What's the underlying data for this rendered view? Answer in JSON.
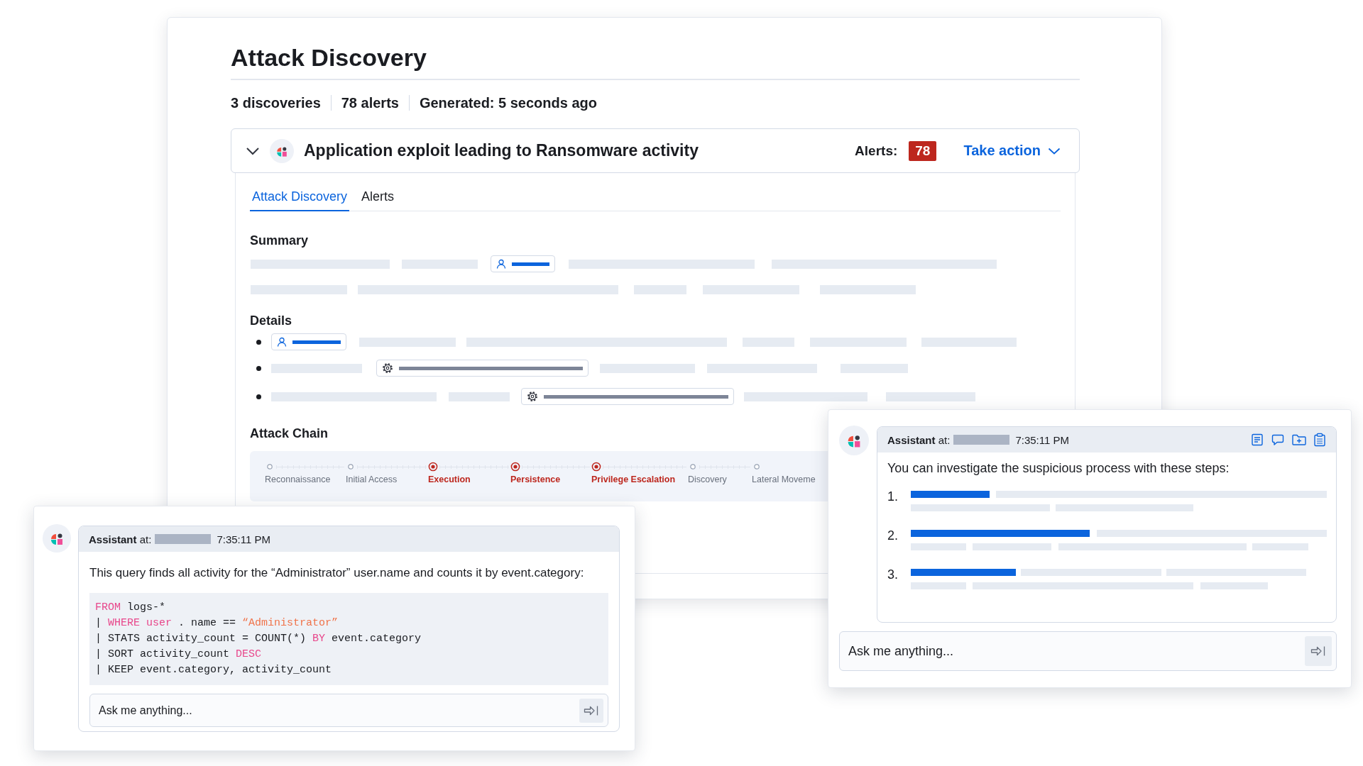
{
  "main": {
    "title": "Attack Discovery",
    "stats": [
      "3 discoveries",
      "78 alerts",
      "Generated: 5 seconds ago"
    ],
    "discovery": {
      "expanded": true,
      "title": "Application exploit leading to Ransomware activity",
      "alerts_label": "Alerts:",
      "alerts_count": "78",
      "action": "Take action"
    },
    "tabs": [
      {
        "label": "Attack Discovery",
        "selected": true
      },
      {
        "label": "Alerts",
        "selected": false
      }
    ],
    "summary_title": "Summary",
    "details_title": "Details",
    "attack_chain_title": "Attack Chain",
    "attack_chain": [
      {
        "label": "Reconnaissance",
        "detected": false
      },
      {
        "label": "Initial Access",
        "detected": false
      },
      {
        "label": "Execution",
        "detected": true
      },
      {
        "label": "Persistence",
        "detected": true
      },
      {
        "label": "Privilege Escalation",
        "detected": true
      },
      {
        "label": "Discovery",
        "detected": false
      },
      {
        "label": "Lateral Moveme",
        "detected": false
      }
    ]
  },
  "chat_left": {
    "author": "**Assistant** at:",
    "time": "7:35:11 PM",
    "message": "This query finds all activity for the “Administrator” user.name and counts it by event.category:",
    "code": [
      [
        {
          "text": "FROM",
          "kind": "keyword"
        },
        {
          "text": " logs-*",
          "kind": "plain"
        }
      ],
      [
        {
          "text": "| ",
          "kind": "plain"
        },
        {
          "text": "WHERE user",
          "kind": "keyword"
        },
        {
          "text": " . name == ",
          "kind": "plain"
        },
        {
          "text": "“Administrator”",
          "kind": "string"
        }
      ],
      [
        {
          "text": "| STATS activity_count = COUNT(*) ",
          "kind": "plain"
        },
        {
          "text": "BY",
          "kind": "keyword"
        },
        {
          "text": " event.category",
          "kind": "plain"
        }
      ],
      [
        {
          "text": "| SORT activity_count ",
          "kind": "plain"
        },
        {
          "text": "DESC",
          "kind": "keyword"
        }
      ],
      [
        {
          "text": "| KEEP event.category, activity_count",
          "kind": "plain"
        }
      ]
    ],
    "placeholder": "Ask me anything..."
  },
  "chat_right": {
    "author": "**Assistant** at:",
    "time": "7:35:11 PM",
    "actions": [
      {
        "kind": "document"
      },
      {
        "kind": "comment"
      },
      {
        "kind": "folder-add"
      },
      {
        "kind": "clipboard"
      }
    ],
    "message": "You can investigate the suspicious process with these steps:",
    "steps": [
      "1.",
      "2.",
      "3."
    ],
    "placeholder": "Ask me anything..."
  }
}
